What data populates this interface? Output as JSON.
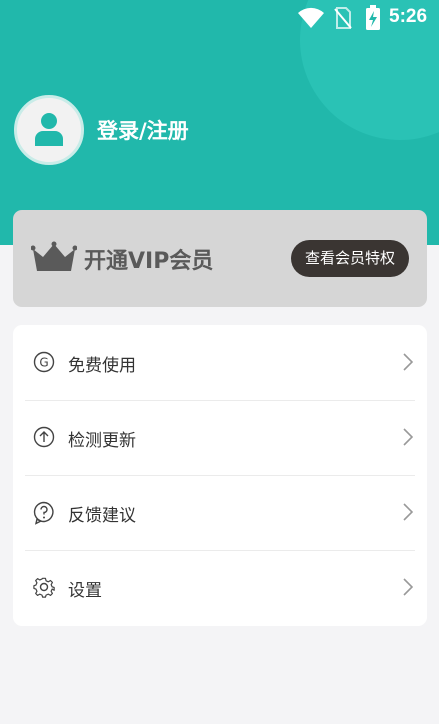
{
  "status_bar": {
    "time": "5:26",
    "icons": [
      "wifi-icon",
      "no-sim-icon",
      "battery-charging-icon"
    ]
  },
  "profile": {
    "login_label": "登录/注册",
    "avatar_icon": "person-icon"
  },
  "vip": {
    "title": "开通VIP会员",
    "button_label": "查看会员特权",
    "icon": "crown-icon"
  },
  "menu": {
    "items": [
      {
        "label": "免费使用",
        "icon": "g-circle-icon"
      },
      {
        "label": "检测更新",
        "icon": "arrow-up-circle-icon"
      },
      {
        "label": "反馈建议",
        "icon": "question-bubble-icon"
      },
      {
        "label": "设置",
        "icon": "gear-icon"
      }
    ]
  },
  "colors": {
    "header": "#21b8ab",
    "vip_button": "#3a3532",
    "background": "#f4f4f6"
  }
}
